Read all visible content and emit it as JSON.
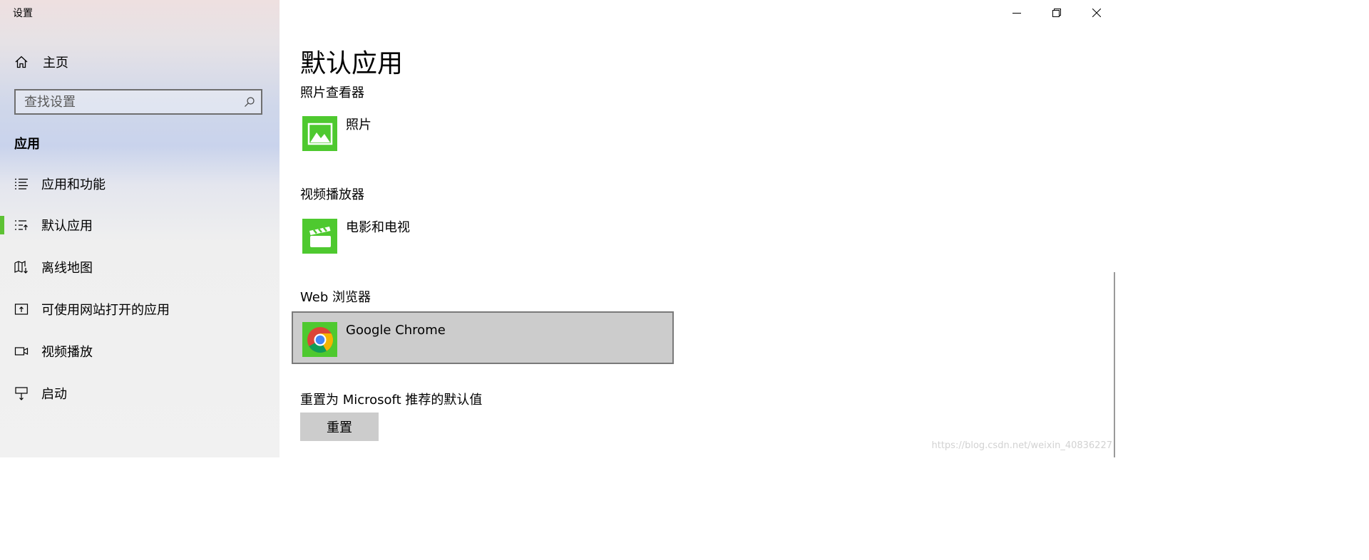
{
  "window": {
    "title": "设置",
    "controls": {
      "minimize": "minimize-icon",
      "restore": "restore-icon",
      "close": "close-icon"
    }
  },
  "sidebar": {
    "home_label": "主页",
    "search_placeholder": "查找设置",
    "section_title": "应用",
    "items": [
      {
        "label": "应用和功能",
        "icon": "apps-features-icon",
        "active": false
      },
      {
        "label": "默认应用",
        "icon": "default-apps-icon",
        "active": true
      },
      {
        "label": "离线地图",
        "icon": "offline-maps-icon",
        "active": false
      },
      {
        "label": "可使用网站打开的应用",
        "icon": "apps-for-websites-icon",
        "active": false
      },
      {
        "label": "视频播放",
        "icon": "video-playback-icon",
        "active": false
      },
      {
        "label": "启动",
        "icon": "startup-icon",
        "active": false
      }
    ],
    "accent_color": "#5dc234"
  },
  "main": {
    "page_title": "默认应用",
    "categories": [
      {
        "label": "照片查看器",
        "app": "照片",
        "icon": "photos-app-icon"
      },
      {
        "label": "视频播放器",
        "app": "电影和电视",
        "icon": "movies-tv-app-icon"
      },
      {
        "label": "Web 浏览器",
        "app": "Google Chrome",
        "icon": "chrome-app-icon",
        "selected": true
      }
    ],
    "reset": {
      "label": "重置为 Microsoft 推荐的默认值",
      "button": "重置"
    },
    "tile_color": "#4ec92f"
  },
  "watermark": "https://blog.csdn.net/weixin_40836227"
}
